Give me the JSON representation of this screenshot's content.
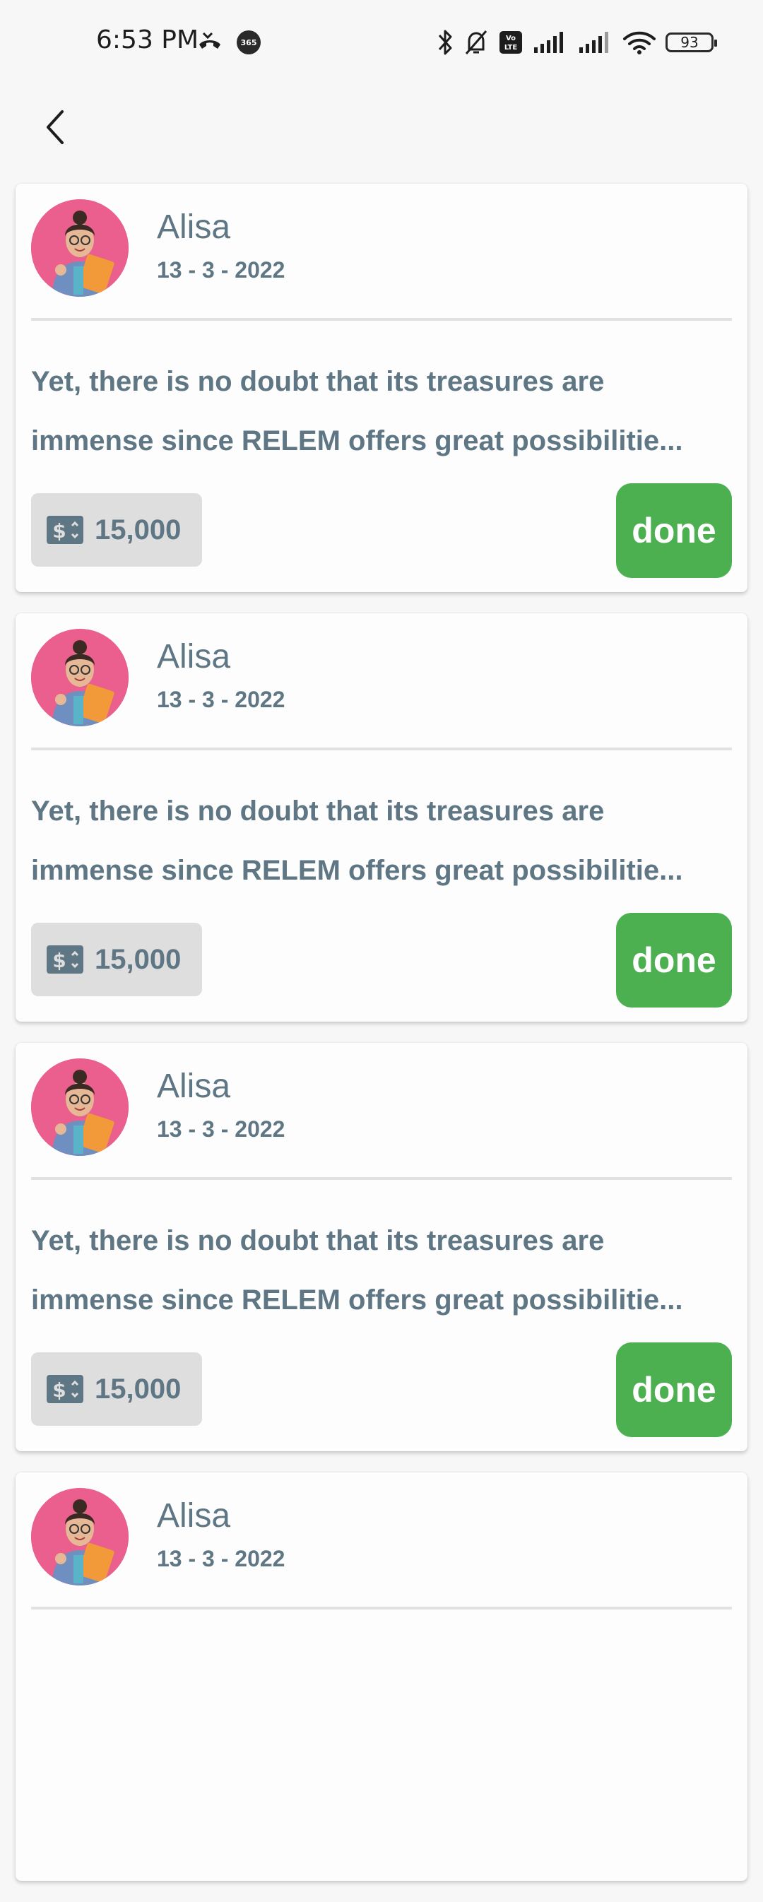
{
  "status_bar": {
    "time": "6:53 PM",
    "battery": "93",
    "icons": [
      "missed-call-icon",
      "app-365-icon",
      "bluetooth-icon",
      "mute-icon",
      "volte-icon",
      "signal-icon",
      "signal-icon",
      "wifi-icon",
      "battery-icon"
    ]
  },
  "header": {
    "back_icon": "chevron-left-icon"
  },
  "colors": {
    "accent_green": "#4caf50",
    "text_slate": "#5f7684",
    "avatar_bg": "#ea5f8d"
  },
  "cards": [
    {
      "name": "Alisa",
      "date": "13 - 3 - 2022",
      "desc_line1": "Yet, there is no doubt that its treasures are",
      "desc_line2": "immense since RELEM offers great possibilitie...",
      "price": "15,000",
      "price_icon": "dollar-icon",
      "action": "done"
    },
    {
      "name": "Alisa",
      "date": "13 - 3 - 2022",
      "desc_line1": "Yet, there is no doubt that its treasures are",
      "desc_line2": "immense since RELEM offers great possibilitie...",
      "price": "15,000",
      "price_icon": "dollar-icon",
      "action": "done"
    },
    {
      "name": "Alisa",
      "date": "13 - 3 - 2022",
      "desc_line1": "Yet, there is no doubt that its treasures are",
      "desc_line2": "immense since RELEM offers great possibilitie...",
      "price": "15,000",
      "price_icon": "dollar-icon",
      "action": "done"
    },
    {
      "name": "Alisa",
      "date": "13 - 3 - 2022"
    }
  ]
}
